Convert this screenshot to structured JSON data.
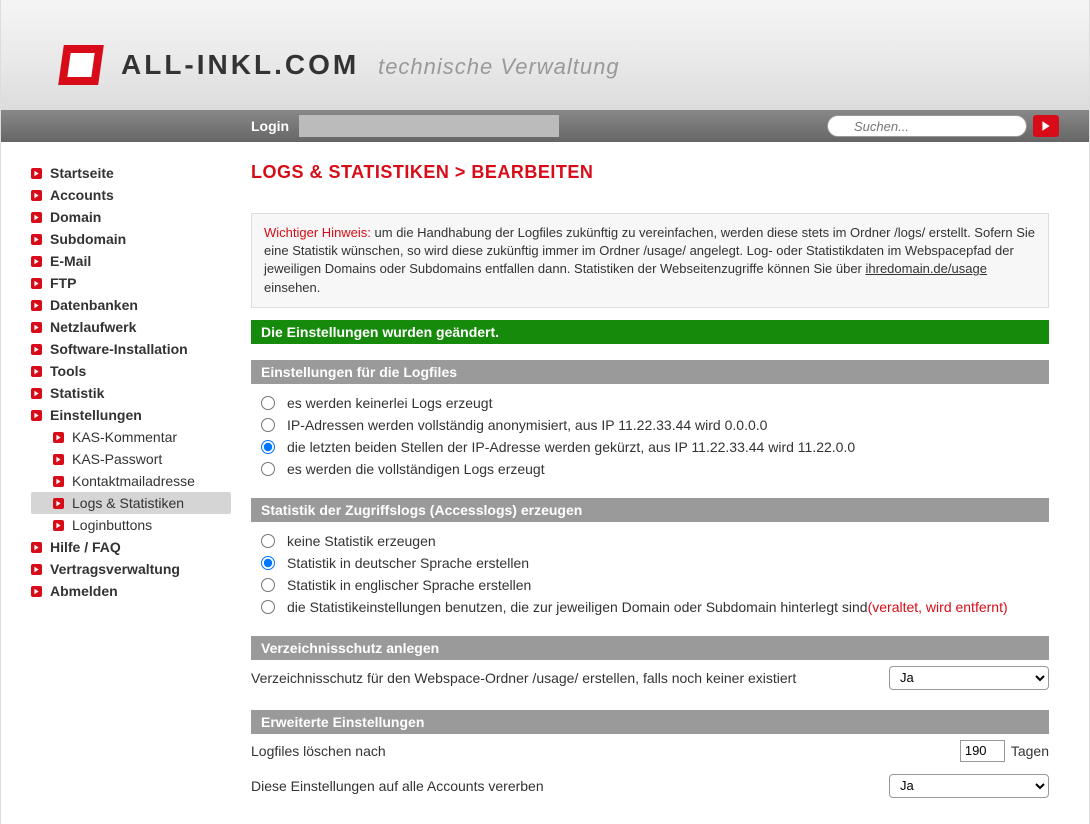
{
  "brand": {
    "name": "ALL-INKL.COM",
    "slogan": "technische Verwaltung"
  },
  "topbar": {
    "login_label": "Login",
    "search_placeholder": "Suchen..."
  },
  "sidebar": {
    "items": [
      {
        "label": "Startseite"
      },
      {
        "label": "Accounts"
      },
      {
        "label": "Domain"
      },
      {
        "label": "Subdomain"
      },
      {
        "label": "E-Mail"
      },
      {
        "label": "FTP"
      },
      {
        "label": "Datenbanken"
      },
      {
        "label": "Netzlaufwerk"
      },
      {
        "label": "Software-Installation"
      },
      {
        "label": "Tools"
      },
      {
        "label": "Statistik"
      },
      {
        "label": "Einstellungen"
      }
    ],
    "sub_items": [
      {
        "label": "KAS-Kommentar"
      },
      {
        "label": "KAS-Passwort"
      },
      {
        "label": "Kontaktmailadresse"
      },
      {
        "label": "Logs & Statistiken",
        "active": true
      },
      {
        "label": "Loginbuttons"
      }
    ],
    "items2": [
      {
        "label": "Hilfe / FAQ"
      },
      {
        "label": "Vertragsverwaltung"
      },
      {
        "label": "Abmelden"
      }
    ]
  },
  "breadcrumb": "LOGS & STATISTIKEN > BEARBEITEN",
  "notice": {
    "highlight": "Wichtiger Hinweis:",
    "text": " um die Handhabung der Logfiles zukünftig zu vereinfachen, werden diese stets im Ordner /logs/ erstellt. Sofern Sie eine Statistik wünschen, so wird diese zukünftig immer im Ordner /usage/ angelegt. Log- oder Statistikdaten im Webspacepfad der jeweiligen Domains oder Subdomains entfallen dann. Statistiken der Webseitenzugriffe können Sie über ",
    "link": "ihredomain.de/usage",
    "text2": " einsehen."
  },
  "success_msg": "Die Einstellungen wurden geändert.",
  "section1": {
    "head": "Einstellungen für die Logfiles",
    "options": [
      "es werden keinerlei Logs erzeugt",
      "IP-Adressen werden vollständig anonymisiert, aus IP 11.22.33.44 wird 0.0.0.0",
      "die letzten beiden Stellen der IP-Adresse werden gekürzt, aus IP 11.22.33.44 wird 11.22.0.0",
      "es werden die vollständigen Logs erzeugt"
    ],
    "selected": 2
  },
  "section2": {
    "head": "Statistik der Zugriffslogs (Accesslogs) erzeugen",
    "options": [
      "keine Statistik erzeugen",
      "Statistik in deutscher Sprache erstellen",
      "Statistik in englischer Sprache erstellen",
      "die Statistikeinstellungen benutzen, die zur jeweiligen Domain oder Subdomain hinterlegt sind "
    ],
    "option3_red": "(veraltet, wird entfernt)",
    "selected": 1
  },
  "section3": {
    "head": "Verzeichnisschutz anlegen",
    "row_label": "Verzeichnisschutz für den Webspace-Ordner /usage/ erstellen, falls noch keiner existiert",
    "select_value": "Ja"
  },
  "section4": {
    "head": "Erweiterte Einstellungen",
    "row1_label": "Logfiles löschen nach",
    "row1_value": "190",
    "row1_unit": "Tagen",
    "row2_label": "Diese Einstellungen auf alle Accounts vererben",
    "row2_select": "Ja"
  }
}
